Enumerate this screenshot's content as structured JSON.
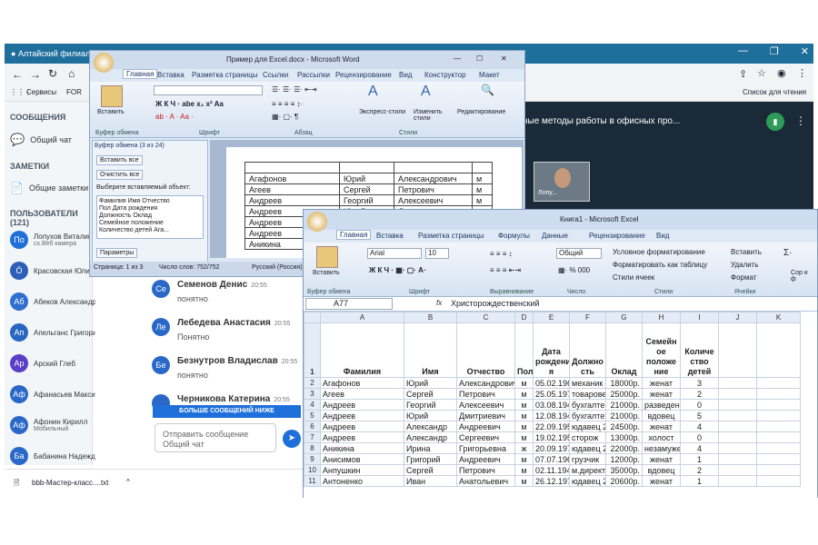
{
  "browser": {
    "tab_title": "Алтайский филиал",
    "bookmarks": {
      "services": "Сервисы",
      "for": "FOR",
      "reading_list": "Список для чтения"
    }
  },
  "bbb": {
    "messages_header": "СООБЩЕНИЯ",
    "public_chat": "Общий чат",
    "notes_header": "ЗАМЕТКИ",
    "shared_notes": "Общие заметки",
    "users_header": "ПОЛЬЗОВАТЕЛИ (121)",
    "users": [
      {
        "initials": "Пo",
        "name": "Лопухов Виталий",
        "sub": "сх.Веб камера",
        "color": "#1e6fd9"
      },
      {
        "initials": "Ö",
        "name": "Красовская Юлия",
        "sub": "",
        "color": "#2b5fb8"
      },
      {
        "initials": "Аб",
        "name": "Абеков Александр",
        "sub": "",
        "color": "#2f6fcf"
      },
      {
        "initials": "Ап",
        "name": "Апельганс Григорий",
        "sub": "",
        "color": "#2866c2"
      },
      {
        "initials": "Ар",
        "name": "Арский Глеб",
        "sub": "",
        "color": "#5a3ec8"
      },
      {
        "initials": "Аф",
        "name": "Афанасьев Максим",
        "sub": "",
        "color": "#2a68c8"
      },
      {
        "initials": "Аф",
        "name": "Афонин Кирилл",
        "sub": "Мобильный",
        "color": "#2a68c8"
      },
      {
        "initials": "Ба",
        "name": "Бабанина Надежда",
        "sub": "",
        "color": "#2a68c8"
      }
    ],
    "chat": [
      {
        "initials": "Се",
        "name": "Семенов Денис",
        "time": "20:55",
        "text": "понятно",
        "color": "#2a68c8"
      },
      {
        "initials": "Ле",
        "name": "Лебедева Анастасия",
        "time": "20:55",
        "text": "Понятно",
        "color": "#2a68c8"
      },
      {
        "initials": "Бе",
        "name": "Безнутров Владислав",
        "time": "20:55",
        "text": "понятно",
        "color": "#2a68c8"
      },
      {
        "initials": "",
        "name": "Черникова Катерина",
        "time": "20:55",
        "text": "",
        "color": "#2a68c8"
      }
    ],
    "more_messages": "БОЛЬШЕ СООБЩЕНИЙ НИЖЕ",
    "chat_placeholder": "Отправить сообщение Общий чат",
    "presentation_title": "ные методы работы в офисных про...",
    "cam_label": "Лопу...",
    "download_file": "bbb-Мастер-класс....txt"
  },
  "word": {
    "title": "Пример для Excel.docx - Microsoft Word",
    "tabs": [
      "Главная",
      "Вставка",
      "Разметка страницы",
      "Ссылки",
      "Рассылки",
      "Рецензирование",
      "Вид",
      "Конструктор",
      "Макет"
    ],
    "ribbon": {
      "paste": "Вставить",
      "clipboard_group": "Буфер обмена",
      "font_group": "Шрифт",
      "paragraph_group": "Абзац",
      "styles_group": "Стили",
      "express_styles": "Экспресс-стили",
      "change_styles": "Изменить стили",
      "editing": "Редактирование"
    },
    "clip_pane": {
      "title": "Буфер обмена (3 из 24)",
      "paste_all": "Вставить все",
      "clear_all": "Очистить все",
      "choose": "Выберите вставляемый объект:",
      "item_lines": [
        "Фамилия Имя Отчество",
        "Пол Дата рождения",
        "Должность Оклад",
        "Семейное положение",
        "Количество детей Ага..."
      ],
      "params": "Параметры"
    },
    "table": [
      [
        "",
        "",
        "",
        ""
      ],
      [
        "Агафонов",
        "Юрий",
        "Александрович",
        "м"
      ],
      [
        "Агеев",
        "Сергей",
        "Петрович",
        "м"
      ],
      [
        "Андреев",
        "Георгий",
        "Алексеевич",
        "м"
      ],
      [
        "Андреев",
        "Юрий",
        "Дмитриевич",
        "м"
      ],
      [
        "Андреев",
        "",
        "",
        "м"
      ],
      [
        "Андреев",
        "",
        "",
        ""
      ],
      [
        "Аникина",
        "",
        "",
        ""
      ]
    ],
    "status": {
      "page": "Страница: 1 из 3",
      "words": "Число слов: 752/752",
      "lang": "Русский (Россия)"
    }
  },
  "excel": {
    "title": "Книга1 - Microsoft Excel",
    "tabs": [
      "Главная",
      "Вставка",
      "Разметка страницы",
      "Формулы",
      "Данные",
      "Рецензирование",
      "Вид"
    ],
    "ribbon": {
      "paste": "Вставить",
      "font_name": "Arial",
      "font_size": "10",
      "number_format": "Общий",
      "cond_format": "Условное форматирование",
      "format_table": "Форматировать как таблицу",
      "cell_styles": "Стили ячеек",
      "insert": "Вставить",
      "delete": "Удалить",
      "format": "Формат",
      "clipboard_group": "Буфер обмена",
      "font_group": "Шрифт",
      "align_group": "Выравнивание",
      "number_group": "Число",
      "styles_group": "Стили",
      "cells_group": "Ячейки",
      "sort_hint": "Сор и ф"
    },
    "name_box": "A77",
    "fx": "fx",
    "formula_value": "Христорождественский",
    "columns": [
      "A",
      "B",
      "C",
      "D",
      "E",
      "F",
      "G",
      "H",
      "I",
      "J",
      "K"
    ],
    "header_row": [
      "Фамилия",
      "Имя",
      "Отчество",
      "Пол",
      "Дата рождени я",
      "Должно сть",
      "Оклад",
      "Семейн ое положе ние",
      "Количе ство детей"
    ],
    "rows": [
      [
        "Агафонов",
        "Юрий",
        "Александрович",
        "м",
        "05.02.1964",
        "механик",
        "18000р.",
        "женат",
        "3"
      ],
      [
        "Агеев",
        "Сергей",
        "Петрович",
        "м",
        "25.05.1970",
        "товаровед",
        "25000р.",
        "женат",
        "2"
      ],
      [
        "Андреев",
        "Георгий",
        "Алексеевич",
        "м",
        "03.08.1944",
        "бухгалтер",
        "21000р.",
        "разведен",
        "0"
      ],
      [
        "Андреев",
        "Юрий",
        "Дмитриевич",
        "м",
        "12.08.1942",
        "бухгалтер",
        "21000р.",
        "вдовец",
        "5"
      ],
      [
        "Андреев",
        "Александр",
        "Андреевич",
        "м",
        "22.09.1955",
        "юдавец 2к",
        "24500р.",
        "женат",
        "4"
      ],
      [
        "Андреев",
        "Александр",
        "Сергеевич",
        "м",
        "19.02.1951",
        "сторож",
        "13000р.",
        "холост",
        "0"
      ],
      [
        "Аникина",
        "Ирина",
        "Григорьевна",
        "ж",
        "20.09.1973",
        "юдавец 2к",
        "22000р.",
        "незамужем",
        "4"
      ],
      [
        "Анисимов",
        "Григорий",
        "Андреевич",
        "м",
        "07.07.1964",
        "грузчик",
        "12000р.",
        "женат",
        "1"
      ],
      [
        "Анпушкин",
        "Сергей",
        "Петрович",
        "м",
        "02.11.1949",
        "м.директо",
        "35000р.",
        "вдовец",
        "2"
      ],
      [
        "Антоненко",
        "Иван",
        "Анатольевич",
        "м",
        "26.12.1976",
        "юдавец 2к",
        "20600р.",
        "женат",
        "1"
      ]
    ]
  }
}
